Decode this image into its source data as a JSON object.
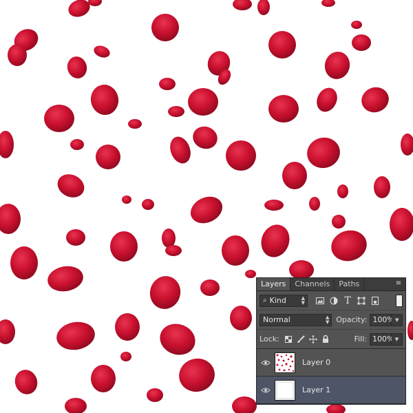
{
  "canvas": {
    "background": "#ffffff",
    "petal_color": "#c8102e",
    "content": "rose-petals-pattern"
  },
  "layers_panel": {
    "tabs": [
      {
        "label": "Layers",
        "active": true
      },
      {
        "label": "Channels",
        "active": false
      },
      {
        "label": "Paths",
        "active": false
      }
    ],
    "menu_icon": "panel-menu-icon",
    "filter": {
      "kind_label": "Kind",
      "icons": [
        "pixel-filter-icon",
        "adjustment-filter-icon",
        "type-filter-icon",
        "shape-filter-icon",
        "smart-object-filter-icon"
      ]
    },
    "blend_mode": "Normal",
    "opacity_label": "Opacity:",
    "opacity_value": "100%",
    "lock_label": "Lock:",
    "lock_icons": [
      "lock-transparent-icon",
      "lock-paint-icon",
      "lock-position-icon",
      "lock-all-icon"
    ],
    "fill_label": "Fill:",
    "fill_value": "100%",
    "layers": [
      {
        "name": "Layer 0",
        "visible": true,
        "selected": false,
        "thumbnail": "petals"
      },
      {
        "name": "Layer 1",
        "visible": true,
        "selected": true,
        "thumbnail": "white"
      }
    ]
  }
}
